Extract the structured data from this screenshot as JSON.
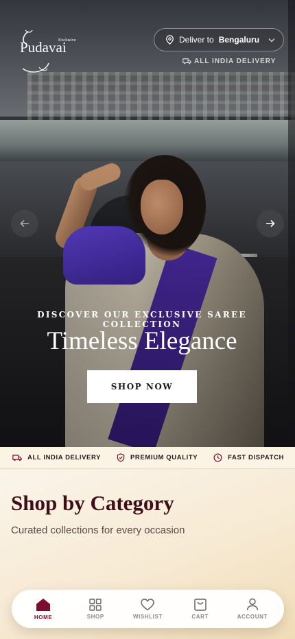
{
  "colors": {
    "brand": "#7a1030",
    "heading": "#3e0d16",
    "cream": "#f7ead3"
  },
  "header": {
    "logo_text": "Pudavai",
    "logo_small": "Exclusive",
    "deliver_prefix": "Deliver to",
    "deliver_city": "Bengaluru",
    "delivery_note": "ALL INDIA DELIVERY"
  },
  "hero": {
    "kicker": "DISCOVER OUR EXCLUSIVE SAREE COLLECTION",
    "title": "Timeless Elegance",
    "cta": "SHOP NOW"
  },
  "trust": [
    {
      "icon": "truck-icon",
      "label": "ALL INDIA DELIVERY"
    },
    {
      "icon": "shield-check-icon",
      "label": "PREMIUM QUALITY"
    },
    {
      "icon": "clock-icon",
      "label": "FAST DISPATCH"
    }
  ],
  "category": {
    "title": "Shop by Category",
    "subtitle": "Curated collections for every occasion"
  },
  "nav": [
    {
      "icon": "home-icon",
      "label": "HOME",
      "active": true
    },
    {
      "icon": "grid-icon",
      "label": "SHOP",
      "active": false
    },
    {
      "icon": "heart-icon",
      "label": "WISHLIST",
      "active": false
    },
    {
      "icon": "cart-icon",
      "label": "CART",
      "active": false
    },
    {
      "icon": "user-icon",
      "label": "ACCOUNT",
      "active": false
    }
  ]
}
